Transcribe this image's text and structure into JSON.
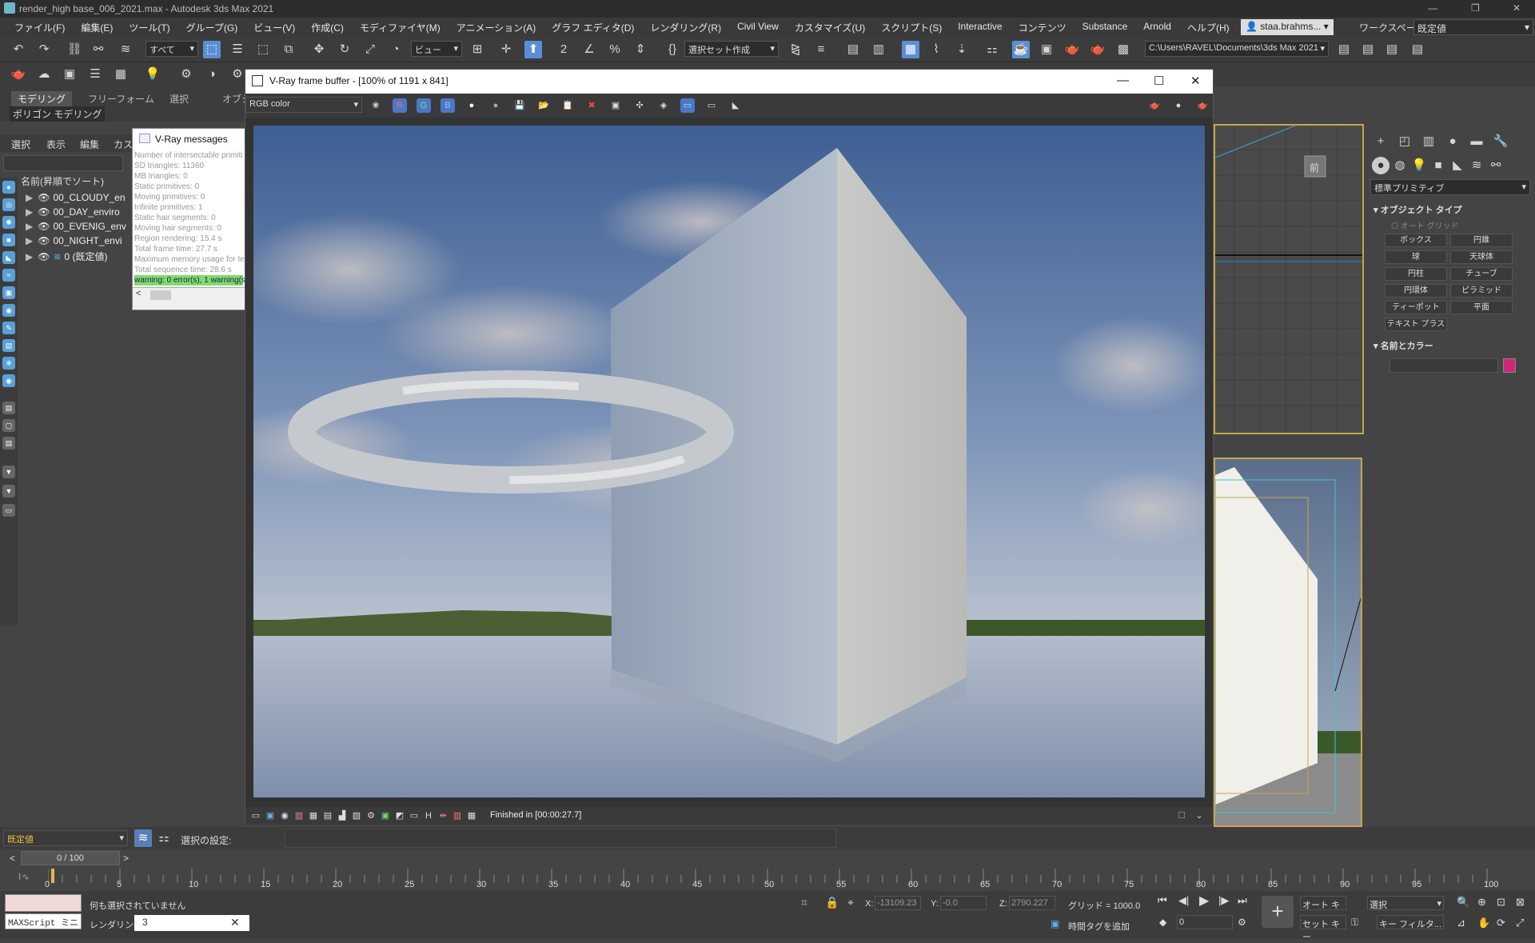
{
  "window": {
    "title": "render_high base_006_2021.max - Autodesk 3ds Max 2021"
  },
  "menu": [
    "ファイル(F)",
    "編集(E)",
    "ツール(T)",
    "グループ(G)",
    "ビュー(V)",
    "作成(C)",
    "モディファイヤ(M)",
    "アニメーション(A)",
    "グラフ エディタ(D)",
    "レンダリング(R)",
    "Civil View",
    "カスタマイズ(U)",
    "スクリプト(S)",
    "Interactive",
    "コンテンツ",
    "Substance",
    "Arnold",
    "ヘルプ(H)"
  ],
  "user": "staa.brahms...",
  "workspace": {
    "label": "ワークスペース:",
    "value": "既定値"
  },
  "toolbar": {
    "filter": "すべて",
    "view": "ビュー",
    "selset": "選択セット作成",
    "path": "C:\\Users\\RAVEL\\Documents\\3ds Max 2021"
  },
  "ribbon": {
    "tabs": [
      "モデリング",
      "フリーフォーム",
      "選択",
      "オブジ"
    ],
    "sub": "ポリゴン モデリング"
  },
  "scene_explorer": {
    "tabs": [
      "選択",
      "表示",
      "編集",
      "カス"
    ],
    "header": "名前(昇順でソート)",
    "layers": [
      "00_CLOUDY_en",
      "00_DAY_enviro",
      "00_EVENIG_env",
      "00_NIGHT_envi",
      "0 (既定値)"
    ]
  },
  "vray_messages": {
    "title": "V-Ray messages",
    "lines": [
      "Number of intersectable primiti",
      "SD triangles: 11360",
      "MB triangles: 0",
      "Static primitives: 0",
      "Moving primitives: 0",
      "Infinite primitives: 1",
      "Static hair segments: 0",
      "Moving hair segments: 0",
      "Region rendering: 15.4 s",
      "Total frame time: 27.7 s",
      "Maximum memory usage for te",
      "Total sequence time: 28.6 s"
    ],
    "warning": "warning: 0 error(s), 1 warning(s"
  },
  "vfb": {
    "title": "V-Ray frame buffer - [100% of 1191 x 841]",
    "channel": "RGB color",
    "status": "Finished in [00:00:27.7]"
  },
  "command_panel": {
    "category": "標準プリミティブ",
    "object_type": "オブジェクト タイプ",
    "autogrid": "オート グリッド",
    "buttons": [
      "ボックス",
      "円錐",
      "球",
      "天球体",
      "円柱",
      "チューブ",
      "円環体",
      "ピラミッド",
      "ティーポット",
      "平面",
      "テキスト プラス"
    ],
    "name_color": "名前とカラー",
    "color": "#d0267a"
  },
  "viewport": {
    "label": "前"
  },
  "bottom": {
    "preset": "既定値",
    "selection_settings": "選択の設定:",
    "frame": "0 / 100"
  },
  "timeline": {
    "ticks": [
      "0",
      "5",
      "10",
      "15",
      "20",
      "25",
      "30",
      "35",
      "40",
      "45",
      "50",
      "55",
      "60",
      "65",
      "70",
      "75",
      "80",
      "85",
      "90",
      "95",
      "100"
    ]
  },
  "statusbar": {
    "msg1": "何も選択されていません",
    "msg2": "レンダリング時",
    "maxscript": "MAXScript ミニ",
    "x_label": "X:",
    "x": "-13109.23",
    "y_label": "Y:",
    "y": "-0.0",
    "z_label": "Z:",
    "z": "2790.227",
    "grid": "グリッド = 1000.0",
    "addtag": "時間タグを追加",
    "autokey": "オート キー",
    "setkey": "セット キー",
    "select": "選択",
    "keyfilter": "キー フィルタ...",
    "frame_val": "0"
  }
}
